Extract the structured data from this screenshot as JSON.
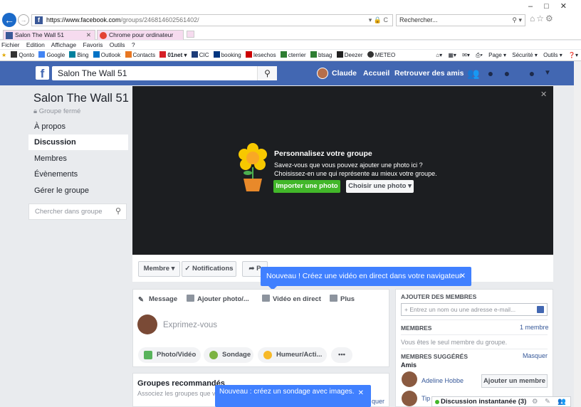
{
  "browser": {
    "url_host": "https://www.facebook.com",
    "url_path": "/groups/246814602561402/",
    "addr_icons": "▾ 🔒 C",
    "search_placeholder": "Rechercher...",
    "tabs": [
      {
        "label": "Salon The Wall 51"
      },
      {
        "label": "Chrome pour ordinateur"
      }
    ],
    "menu": [
      "Fichier",
      "Edition",
      "Affichage",
      "Favoris",
      "Outils",
      "?"
    ],
    "favorites": [
      "Qonto",
      "Google",
      "Bing",
      "Outlook",
      "Contacts",
      "01net ▾",
      "CIC",
      "booking",
      "lesechos",
      "cterrier",
      "btsag",
      "Deezer",
      "METEO"
    ],
    "fav_right": [
      "Page ▾",
      "Sécurité ▾",
      "Outils ▾"
    ]
  },
  "fb": {
    "search_value": "Salon The Wall 51",
    "user_name": "Claude",
    "nav_home": "Accueil",
    "nav_find_friends": "Retrouver des amis"
  },
  "group": {
    "title": "Salon The Wall 51",
    "privacy": "Groupe fermé",
    "nav": [
      "À propos",
      "Discussion",
      "Membres",
      "Évènements",
      "Gérer le groupe"
    ],
    "search_placeholder": "Chercher dans groupe"
  },
  "cover": {
    "title": "Personnalisez votre groupe",
    "desc1": "Savez-vous que vous pouvez ajouter une photo ici ?",
    "desc2": "Choisissez-en une qui représente au mieux votre groupe.",
    "btn_import": "Importer une photo",
    "btn_choose": "Choisir une photo ▾"
  },
  "actions": {
    "member": "Membre ▾",
    "notifications": "✓ Notifications",
    "share": "➦ P"
  },
  "tooltip1": "Nouveau ! Créez une vidéo en direct dans votre navigateur",
  "composer": {
    "tabs": [
      "Message",
      "Ajouter photo/...",
      "Vidéo en direct",
      "Plus"
    ],
    "placeholder": "Exprimez-vous",
    "pills": [
      "Photo/Vidéo",
      "Sondage",
      "Humeur/Acti...",
      "•••"
    ]
  },
  "recommended": {
    "title": "Groupes recommandés",
    "subtitle": "Associez les groupes que vo"
  },
  "tooltip2": "Nouveau : créez un sondage avec images.",
  "tooltip2_tail": "quer",
  "sidebar": {
    "add_members_header": "AJOUTER DES MEMBRES",
    "add_input_placeholder": "+ Entrez un nom ou une adresse e-mail...",
    "members_header": "MEMBRES",
    "members_count": "1 membre",
    "only_member": "Vous êtes le seul membre du groupe.",
    "suggested_header": "MEMBRES SUGGÉRÉS",
    "hide_link": "Masquer",
    "friends_label": "Amis",
    "suggestions": [
      {
        "name": "Adeline Hobbe",
        "button": "Ajouter un membre"
      },
      {
        "name": "Tip",
        "button": ""
      }
    ]
  },
  "chat": {
    "label": "Discussion instantanée (3)"
  }
}
